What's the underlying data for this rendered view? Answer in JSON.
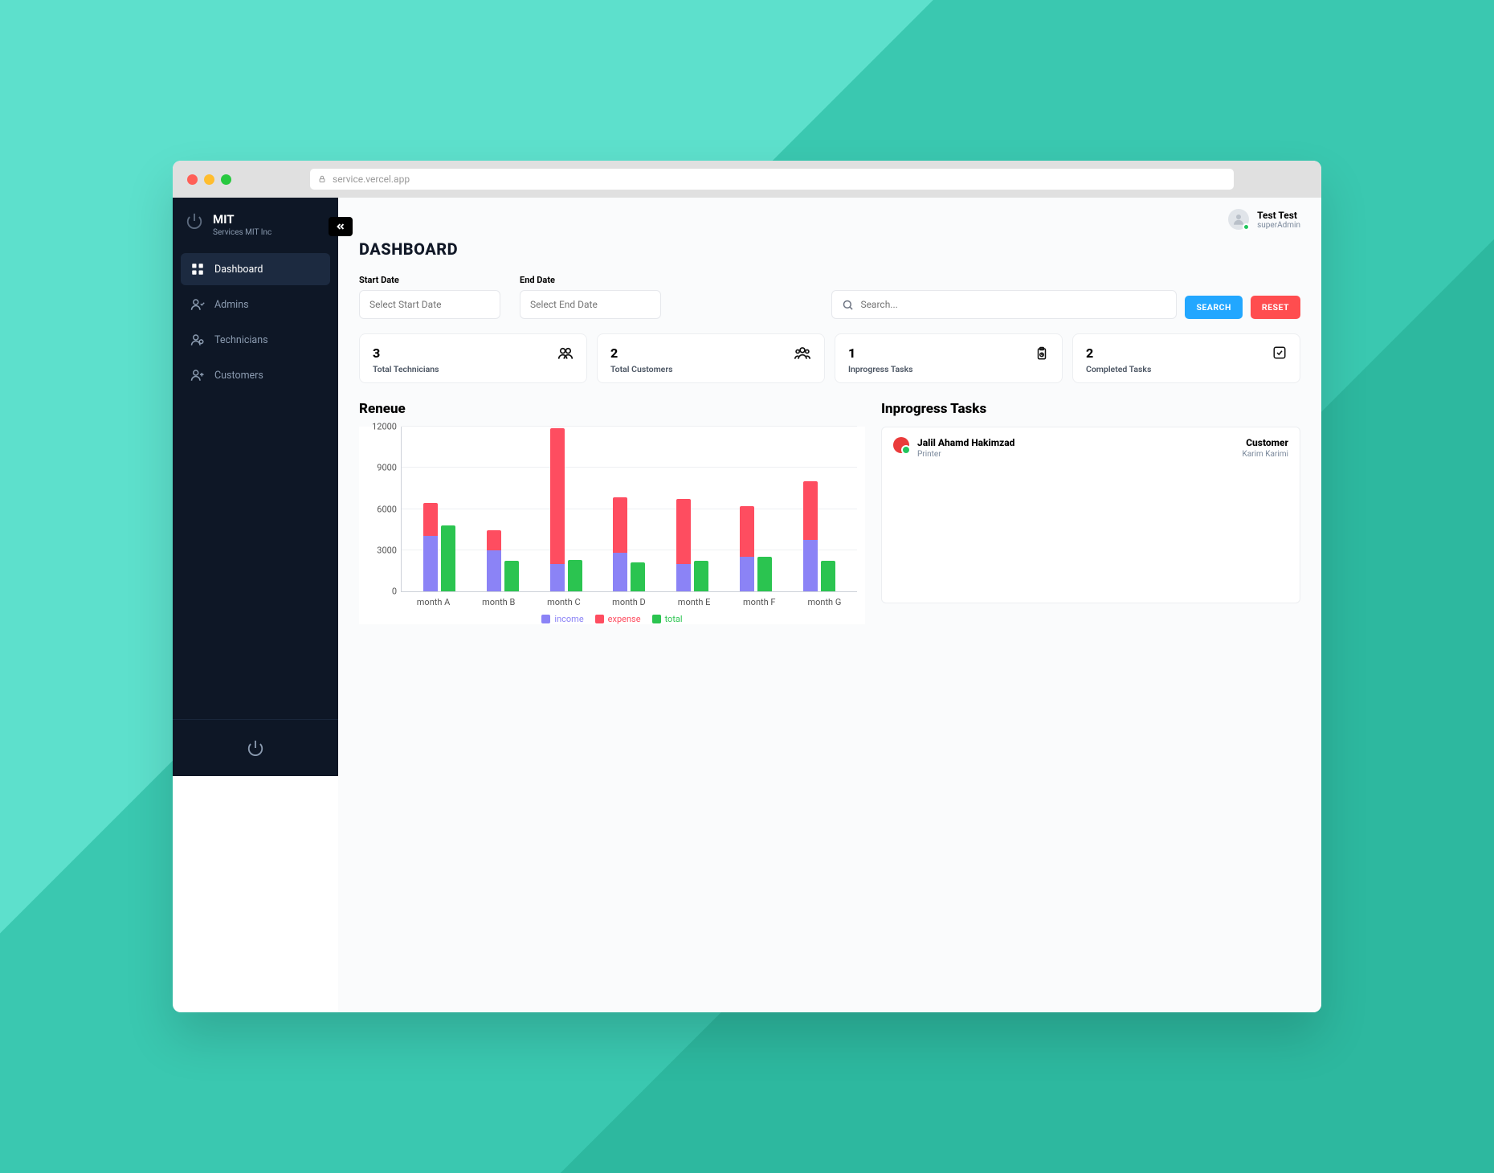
{
  "browser": {
    "url": "service.vercel.app"
  },
  "sidebar": {
    "brand_title": "MIT",
    "brand_sub": "Services MIT Inc",
    "items": [
      {
        "label": "Dashboard"
      },
      {
        "label": "Admins"
      },
      {
        "label": "Technicians"
      },
      {
        "label": "Customers"
      }
    ]
  },
  "user": {
    "name": "Test Test",
    "role": "superAdmin"
  },
  "page": {
    "title": "DASHBOARD",
    "start_label": "Start Date",
    "start_placeholder": "Select Start Date",
    "end_label": "End Date",
    "end_placeholder": "Select End Date",
    "search_placeholder": "Search...",
    "search_btn": "SEARCH",
    "reset_btn": "RESET"
  },
  "stats": [
    {
      "value": "3",
      "label": "Total Technicians",
      "icon": "users"
    },
    {
      "value": "2",
      "label": "Total Customers",
      "icon": "group"
    },
    {
      "value": "1",
      "label": "Inprogress Tasks",
      "icon": "clipboard"
    },
    {
      "value": "2",
      "label": "Completed Tasks",
      "icon": "check"
    }
  ],
  "chart_title": "Reneue",
  "chart_data": {
    "type": "bar",
    "title": "Reneue",
    "xlabel": "",
    "ylabel": "",
    "ylim": [
      0,
      12000
    ],
    "yticks": [
      0,
      3000,
      6000,
      9000,
      12000
    ],
    "categories": [
      "month A",
      "month B",
      "month C",
      "month D",
      "month E",
      "month F",
      "month G"
    ],
    "series": [
      {
        "name": "income",
        "color": "#8b83f6",
        "values": [
          4000,
          3000,
          2000,
          2800,
          2000,
          2500,
          3700
        ]
      },
      {
        "name": "expense",
        "color": "#fe4d60",
        "values": [
          2400,
          1400,
          9800,
          4000,
          4700,
          3700,
          4300
        ]
      },
      {
        "name": "total",
        "color": "#2bc450",
        "values": [
          4800,
          2200,
          2300,
          2100,
          2200,
          2500,
          2200
        ]
      }
    ],
    "legend": [
      "income",
      "expense",
      "total"
    ]
  },
  "tasks_title": "Inprogress Tasks",
  "tasks": [
    {
      "name": "Jalil Ahamd Hakimzad",
      "sub": "Printer",
      "role_label": "Customer",
      "customer": "Karim Karimi"
    }
  ]
}
